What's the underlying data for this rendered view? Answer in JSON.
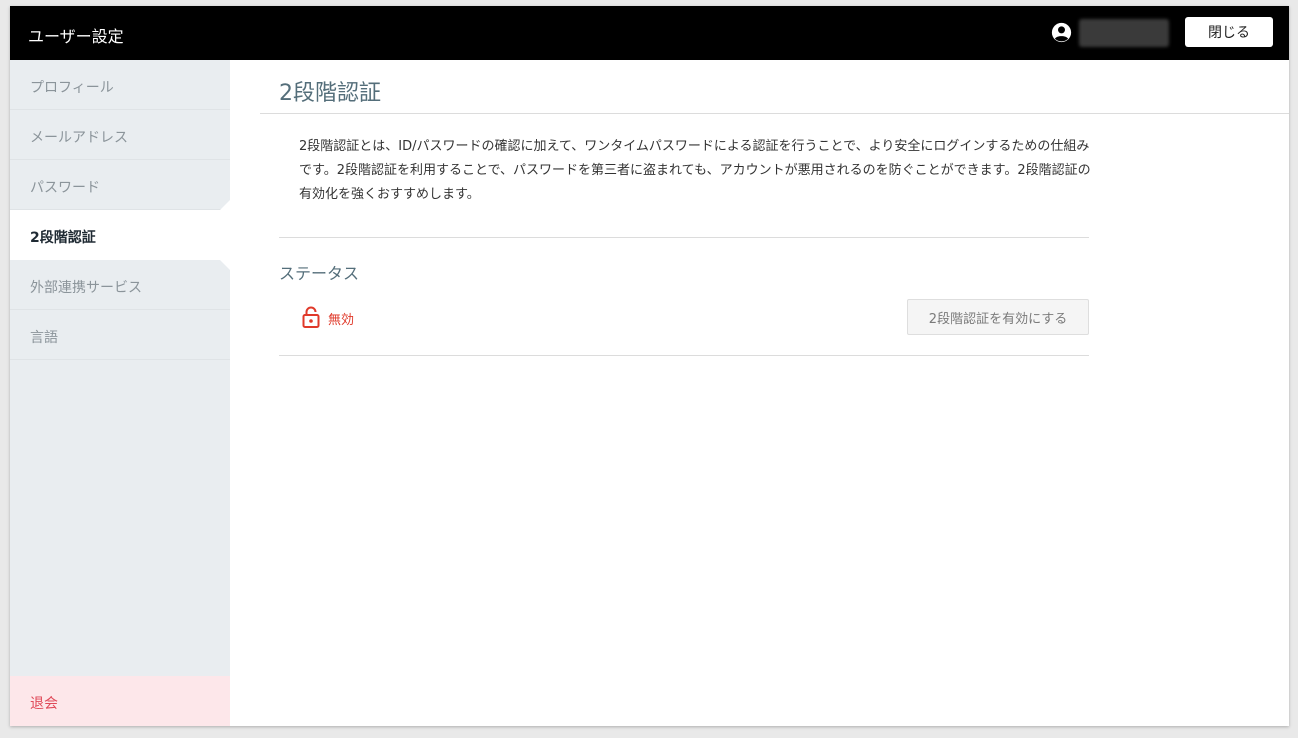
{
  "header": {
    "title": "ユーザー設定",
    "user_icon": "account-circle-icon",
    "close_label": "閉じる"
  },
  "sidebar": {
    "items": [
      {
        "label": "プロフィール"
      },
      {
        "label": "メールアドレス"
      },
      {
        "label": "パスワード"
      },
      {
        "label": "2段階認証",
        "active": true
      },
      {
        "label": "外部連携サービス"
      },
      {
        "label": "言語"
      }
    ],
    "withdraw_label": "退会"
  },
  "main": {
    "title": "2段階認証",
    "description": "2段階認証とは、ID/パスワードの確認に加えて、ワンタイムパスワードによる認証を行うことで、より安全にログインするための仕組みです。2段階認証を利用することで、パスワードを第三者に盗まれても、アカウントが悪用されるのを防ぐことができます。2段階認証の有効化を強くおすすめします。",
    "status": {
      "heading": "ステータス",
      "icon": "unlocked-padlock-icon",
      "value": "無効",
      "enable_button": "2段階認証を有効にする"
    }
  },
  "colors": {
    "header_bg": "#000000",
    "sidebar_bg": "#e9edf0",
    "title_color": "#546e7a",
    "status_disabled": "#e0392a",
    "withdraw_bg": "#fde7ea",
    "withdraw_text": "#e04a59"
  }
}
